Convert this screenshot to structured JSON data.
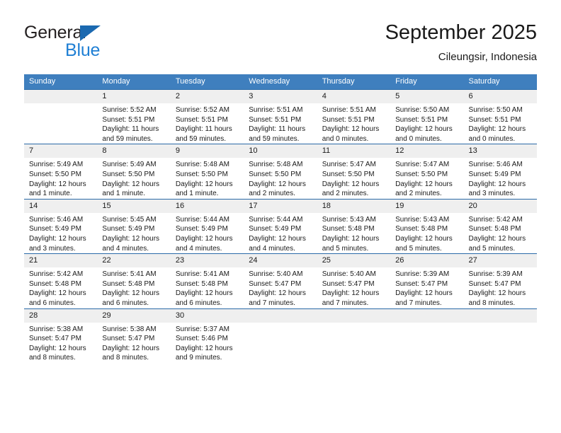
{
  "brand": {
    "name_top": "General",
    "name_bottom": "Blue",
    "triangle_color": "#1b69b0",
    "blue_text_color": "#1f7fd4"
  },
  "header": {
    "title": "September 2025",
    "subtitle": "Cileungsir, Indonesia"
  },
  "theme": {
    "header_row_bg": "#3f7fbe",
    "row_divider": "#2a6aa8",
    "daynum_bg": "#efefef"
  },
  "weekday_headers": [
    "Sunday",
    "Monday",
    "Tuesday",
    "Wednesday",
    "Thursday",
    "Friday",
    "Saturday"
  ],
  "weeks": [
    [
      {
        "day": "",
        "sunrise": "",
        "sunset": "",
        "daylight_line1": "",
        "daylight_line2": ""
      },
      {
        "day": "1",
        "sunrise": "Sunrise: 5:52 AM",
        "sunset": "Sunset: 5:51 PM",
        "daylight_line1": "Daylight: 11 hours",
        "daylight_line2": "and 59 minutes."
      },
      {
        "day": "2",
        "sunrise": "Sunrise: 5:52 AM",
        "sunset": "Sunset: 5:51 PM",
        "daylight_line1": "Daylight: 11 hours",
        "daylight_line2": "and 59 minutes."
      },
      {
        "day": "3",
        "sunrise": "Sunrise: 5:51 AM",
        "sunset": "Sunset: 5:51 PM",
        "daylight_line1": "Daylight: 11 hours",
        "daylight_line2": "and 59 minutes."
      },
      {
        "day": "4",
        "sunrise": "Sunrise: 5:51 AM",
        "sunset": "Sunset: 5:51 PM",
        "daylight_line1": "Daylight: 12 hours",
        "daylight_line2": "and 0 minutes."
      },
      {
        "day": "5",
        "sunrise": "Sunrise: 5:50 AM",
        "sunset": "Sunset: 5:51 PM",
        "daylight_line1": "Daylight: 12 hours",
        "daylight_line2": "and 0 minutes."
      },
      {
        "day": "6",
        "sunrise": "Sunrise: 5:50 AM",
        "sunset": "Sunset: 5:51 PM",
        "daylight_line1": "Daylight: 12 hours",
        "daylight_line2": "and 0 minutes."
      }
    ],
    [
      {
        "day": "7",
        "sunrise": "Sunrise: 5:49 AM",
        "sunset": "Sunset: 5:50 PM",
        "daylight_line1": "Daylight: 12 hours",
        "daylight_line2": "and 1 minute."
      },
      {
        "day": "8",
        "sunrise": "Sunrise: 5:49 AM",
        "sunset": "Sunset: 5:50 PM",
        "daylight_line1": "Daylight: 12 hours",
        "daylight_line2": "and 1 minute."
      },
      {
        "day": "9",
        "sunrise": "Sunrise: 5:48 AM",
        "sunset": "Sunset: 5:50 PM",
        "daylight_line1": "Daylight: 12 hours",
        "daylight_line2": "and 1 minute."
      },
      {
        "day": "10",
        "sunrise": "Sunrise: 5:48 AM",
        "sunset": "Sunset: 5:50 PM",
        "daylight_line1": "Daylight: 12 hours",
        "daylight_line2": "and 2 minutes."
      },
      {
        "day": "11",
        "sunrise": "Sunrise: 5:47 AM",
        "sunset": "Sunset: 5:50 PM",
        "daylight_line1": "Daylight: 12 hours",
        "daylight_line2": "and 2 minutes."
      },
      {
        "day": "12",
        "sunrise": "Sunrise: 5:47 AM",
        "sunset": "Sunset: 5:50 PM",
        "daylight_line1": "Daylight: 12 hours",
        "daylight_line2": "and 2 minutes."
      },
      {
        "day": "13",
        "sunrise": "Sunrise: 5:46 AM",
        "sunset": "Sunset: 5:49 PM",
        "daylight_line1": "Daylight: 12 hours",
        "daylight_line2": "and 3 minutes."
      }
    ],
    [
      {
        "day": "14",
        "sunrise": "Sunrise: 5:46 AM",
        "sunset": "Sunset: 5:49 PM",
        "daylight_line1": "Daylight: 12 hours",
        "daylight_line2": "and 3 minutes."
      },
      {
        "day": "15",
        "sunrise": "Sunrise: 5:45 AM",
        "sunset": "Sunset: 5:49 PM",
        "daylight_line1": "Daylight: 12 hours",
        "daylight_line2": "and 4 minutes."
      },
      {
        "day": "16",
        "sunrise": "Sunrise: 5:44 AM",
        "sunset": "Sunset: 5:49 PM",
        "daylight_line1": "Daylight: 12 hours",
        "daylight_line2": "and 4 minutes."
      },
      {
        "day": "17",
        "sunrise": "Sunrise: 5:44 AM",
        "sunset": "Sunset: 5:49 PM",
        "daylight_line1": "Daylight: 12 hours",
        "daylight_line2": "and 4 minutes."
      },
      {
        "day": "18",
        "sunrise": "Sunrise: 5:43 AM",
        "sunset": "Sunset: 5:48 PM",
        "daylight_line1": "Daylight: 12 hours",
        "daylight_line2": "and 5 minutes."
      },
      {
        "day": "19",
        "sunrise": "Sunrise: 5:43 AM",
        "sunset": "Sunset: 5:48 PM",
        "daylight_line1": "Daylight: 12 hours",
        "daylight_line2": "and 5 minutes."
      },
      {
        "day": "20",
        "sunrise": "Sunrise: 5:42 AM",
        "sunset": "Sunset: 5:48 PM",
        "daylight_line1": "Daylight: 12 hours",
        "daylight_line2": "and 5 minutes."
      }
    ],
    [
      {
        "day": "21",
        "sunrise": "Sunrise: 5:42 AM",
        "sunset": "Sunset: 5:48 PM",
        "daylight_line1": "Daylight: 12 hours",
        "daylight_line2": "and 6 minutes."
      },
      {
        "day": "22",
        "sunrise": "Sunrise: 5:41 AM",
        "sunset": "Sunset: 5:48 PM",
        "daylight_line1": "Daylight: 12 hours",
        "daylight_line2": "and 6 minutes."
      },
      {
        "day": "23",
        "sunrise": "Sunrise: 5:41 AM",
        "sunset": "Sunset: 5:48 PM",
        "daylight_line1": "Daylight: 12 hours",
        "daylight_line2": "and 6 minutes."
      },
      {
        "day": "24",
        "sunrise": "Sunrise: 5:40 AM",
        "sunset": "Sunset: 5:47 PM",
        "daylight_line1": "Daylight: 12 hours",
        "daylight_line2": "and 7 minutes."
      },
      {
        "day": "25",
        "sunrise": "Sunrise: 5:40 AM",
        "sunset": "Sunset: 5:47 PM",
        "daylight_line1": "Daylight: 12 hours",
        "daylight_line2": "and 7 minutes."
      },
      {
        "day": "26",
        "sunrise": "Sunrise: 5:39 AM",
        "sunset": "Sunset: 5:47 PM",
        "daylight_line1": "Daylight: 12 hours",
        "daylight_line2": "and 7 minutes."
      },
      {
        "day": "27",
        "sunrise": "Sunrise: 5:39 AM",
        "sunset": "Sunset: 5:47 PM",
        "daylight_line1": "Daylight: 12 hours",
        "daylight_line2": "and 8 minutes."
      }
    ],
    [
      {
        "day": "28",
        "sunrise": "Sunrise: 5:38 AM",
        "sunset": "Sunset: 5:47 PM",
        "daylight_line1": "Daylight: 12 hours",
        "daylight_line2": "and 8 minutes."
      },
      {
        "day": "29",
        "sunrise": "Sunrise: 5:38 AM",
        "sunset": "Sunset: 5:47 PM",
        "daylight_line1": "Daylight: 12 hours",
        "daylight_line2": "and 8 minutes."
      },
      {
        "day": "30",
        "sunrise": "Sunrise: 5:37 AM",
        "sunset": "Sunset: 5:46 PM",
        "daylight_line1": "Daylight: 12 hours",
        "daylight_line2": "and 9 minutes."
      },
      {
        "day": "",
        "sunrise": "",
        "sunset": "",
        "daylight_line1": "",
        "daylight_line2": ""
      },
      {
        "day": "",
        "sunrise": "",
        "sunset": "",
        "daylight_line1": "",
        "daylight_line2": ""
      },
      {
        "day": "",
        "sunrise": "",
        "sunset": "",
        "daylight_line1": "",
        "daylight_line2": ""
      },
      {
        "day": "",
        "sunrise": "",
        "sunset": "",
        "daylight_line1": "",
        "daylight_line2": ""
      }
    ]
  ]
}
